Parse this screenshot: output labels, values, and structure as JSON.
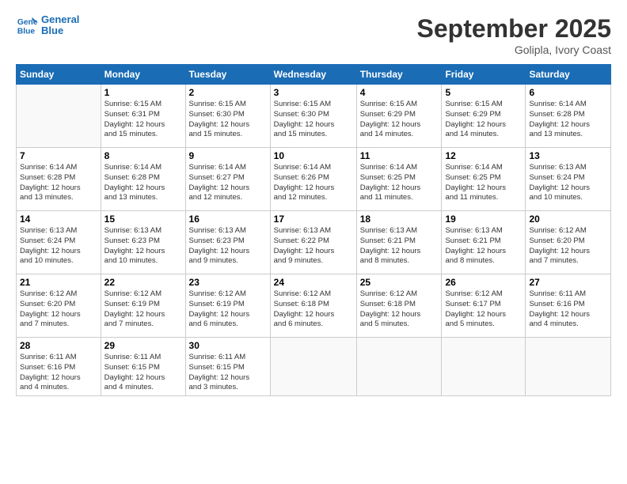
{
  "header": {
    "logo_line1": "General",
    "logo_line2": "Blue",
    "month": "September 2025",
    "location": "Golipla, Ivory Coast"
  },
  "weekdays": [
    "Sunday",
    "Monday",
    "Tuesday",
    "Wednesday",
    "Thursday",
    "Friday",
    "Saturday"
  ],
  "weeks": [
    [
      {
        "day": "",
        "info": ""
      },
      {
        "day": "1",
        "info": "Sunrise: 6:15 AM\nSunset: 6:31 PM\nDaylight: 12 hours\nand 15 minutes."
      },
      {
        "day": "2",
        "info": "Sunrise: 6:15 AM\nSunset: 6:30 PM\nDaylight: 12 hours\nand 15 minutes."
      },
      {
        "day": "3",
        "info": "Sunrise: 6:15 AM\nSunset: 6:30 PM\nDaylight: 12 hours\nand 15 minutes."
      },
      {
        "day": "4",
        "info": "Sunrise: 6:15 AM\nSunset: 6:29 PM\nDaylight: 12 hours\nand 14 minutes."
      },
      {
        "day": "5",
        "info": "Sunrise: 6:15 AM\nSunset: 6:29 PM\nDaylight: 12 hours\nand 14 minutes."
      },
      {
        "day": "6",
        "info": "Sunrise: 6:14 AM\nSunset: 6:28 PM\nDaylight: 12 hours\nand 13 minutes."
      }
    ],
    [
      {
        "day": "7",
        "info": "Sunrise: 6:14 AM\nSunset: 6:28 PM\nDaylight: 12 hours\nand 13 minutes."
      },
      {
        "day": "8",
        "info": "Sunrise: 6:14 AM\nSunset: 6:28 PM\nDaylight: 12 hours\nand 13 minutes."
      },
      {
        "day": "9",
        "info": "Sunrise: 6:14 AM\nSunset: 6:27 PM\nDaylight: 12 hours\nand 12 minutes."
      },
      {
        "day": "10",
        "info": "Sunrise: 6:14 AM\nSunset: 6:26 PM\nDaylight: 12 hours\nand 12 minutes."
      },
      {
        "day": "11",
        "info": "Sunrise: 6:14 AM\nSunset: 6:25 PM\nDaylight: 12 hours\nand 11 minutes."
      },
      {
        "day": "12",
        "info": "Sunrise: 6:14 AM\nSunset: 6:25 PM\nDaylight: 12 hours\nand 11 minutes."
      },
      {
        "day": "13",
        "info": "Sunrise: 6:13 AM\nSunset: 6:24 PM\nDaylight: 12 hours\nand 10 minutes."
      }
    ],
    [
      {
        "day": "14",
        "info": "Sunrise: 6:13 AM\nSunset: 6:24 PM\nDaylight: 12 hours\nand 10 minutes."
      },
      {
        "day": "15",
        "info": "Sunrise: 6:13 AM\nSunset: 6:23 PM\nDaylight: 12 hours\nand 10 minutes."
      },
      {
        "day": "16",
        "info": "Sunrise: 6:13 AM\nSunset: 6:23 PM\nDaylight: 12 hours\nand 9 minutes."
      },
      {
        "day": "17",
        "info": "Sunrise: 6:13 AM\nSunset: 6:22 PM\nDaylight: 12 hours\nand 9 minutes."
      },
      {
        "day": "18",
        "info": "Sunrise: 6:13 AM\nSunset: 6:21 PM\nDaylight: 12 hours\nand 8 minutes."
      },
      {
        "day": "19",
        "info": "Sunrise: 6:13 AM\nSunset: 6:21 PM\nDaylight: 12 hours\nand 8 minutes."
      },
      {
        "day": "20",
        "info": "Sunrise: 6:12 AM\nSunset: 6:20 PM\nDaylight: 12 hours\nand 7 minutes."
      }
    ],
    [
      {
        "day": "21",
        "info": "Sunrise: 6:12 AM\nSunset: 6:20 PM\nDaylight: 12 hours\nand 7 minutes."
      },
      {
        "day": "22",
        "info": "Sunrise: 6:12 AM\nSunset: 6:19 PM\nDaylight: 12 hours\nand 7 minutes."
      },
      {
        "day": "23",
        "info": "Sunrise: 6:12 AM\nSunset: 6:19 PM\nDaylight: 12 hours\nand 6 minutes."
      },
      {
        "day": "24",
        "info": "Sunrise: 6:12 AM\nSunset: 6:18 PM\nDaylight: 12 hours\nand 6 minutes."
      },
      {
        "day": "25",
        "info": "Sunrise: 6:12 AM\nSunset: 6:18 PM\nDaylight: 12 hours\nand 5 minutes."
      },
      {
        "day": "26",
        "info": "Sunrise: 6:12 AM\nSunset: 6:17 PM\nDaylight: 12 hours\nand 5 minutes."
      },
      {
        "day": "27",
        "info": "Sunrise: 6:11 AM\nSunset: 6:16 PM\nDaylight: 12 hours\nand 4 minutes."
      }
    ],
    [
      {
        "day": "28",
        "info": "Sunrise: 6:11 AM\nSunset: 6:16 PM\nDaylight: 12 hours\nand 4 minutes."
      },
      {
        "day": "29",
        "info": "Sunrise: 6:11 AM\nSunset: 6:15 PM\nDaylight: 12 hours\nand 4 minutes."
      },
      {
        "day": "30",
        "info": "Sunrise: 6:11 AM\nSunset: 6:15 PM\nDaylight: 12 hours\nand 3 minutes."
      },
      {
        "day": "",
        "info": ""
      },
      {
        "day": "",
        "info": ""
      },
      {
        "day": "",
        "info": ""
      },
      {
        "day": "",
        "info": ""
      }
    ]
  ]
}
